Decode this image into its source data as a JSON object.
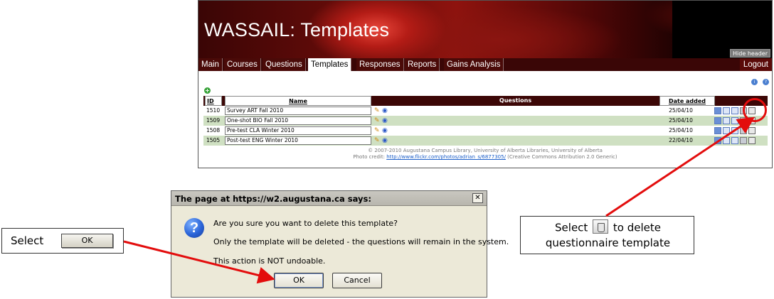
{
  "app": {
    "title": "WASSAIL: Templates",
    "hide_header_label": "Hide header",
    "logout_label": "Logout"
  },
  "tabs": [
    {
      "label": "Main"
    },
    {
      "label": "Courses"
    },
    {
      "label": "Questions"
    },
    {
      "label": "Templates",
      "active": true
    },
    {
      "label": "Responses"
    },
    {
      "label": "Reports"
    },
    {
      "label": "Gains Analysis"
    }
  ],
  "table": {
    "headers": {
      "id": "ID",
      "name": "Name",
      "questions": "Questions",
      "date_added": "Date added"
    },
    "rows": [
      {
        "id": "1510",
        "name": "Survey ART Fall 2010",
        "date": "25/04/10"
      },
      {
        "id": "1509",
        "name": "One-shot BIO Fall 2010",
        "date": "25/04/10"
      },
      {
        "id": "1508",
        "name": "Pre-test CLA Winter 2010",
        "date": "25/04/10"
      },
      {
        "id": "1505",
        "name": "Post-test ENG Winter 2010",
        "date": "22/04/10"
      }
    ]
  },
  "footer": {
    "copyright": "© 2007-2010 Augustana Campus Library, University of Alberta Libraries, University of Alberta",
    "photo_credit_prefix": "Photo credit: ",
    "photo_credit_link": "http://www.flickr.com/photos/adrian_s/6877305/",
    "photo_credit_suffix": " (Creative Commons Attribution 2.0 Generic)"
  },
  "dialog": {
    "title": "The page at https://w2.augustana.ca says:",
    "line1": "Are you sure you want to delete this template?",
    "line2": "Only the template will be deleted - the questions will remain in the system.",
    "line3": "This action is NOT undoable.",
    "ok_label": "OK",
    "cancel_label": "Cancel",
    "close_glyph": "✕"
  },
  "callouts": {
    "left_label": "Select",
    "left_button": "OK",
    "right_line1_before": "Select",
    "right_line1_after": "to delete",
    "right_line2": "questionnaire template"
  },
  "colors": {
    "annotation_red": "#e30d0d",
    "odd_row": "#cfe0c2",
    "header_bar": "#3c0706"
  }
}
